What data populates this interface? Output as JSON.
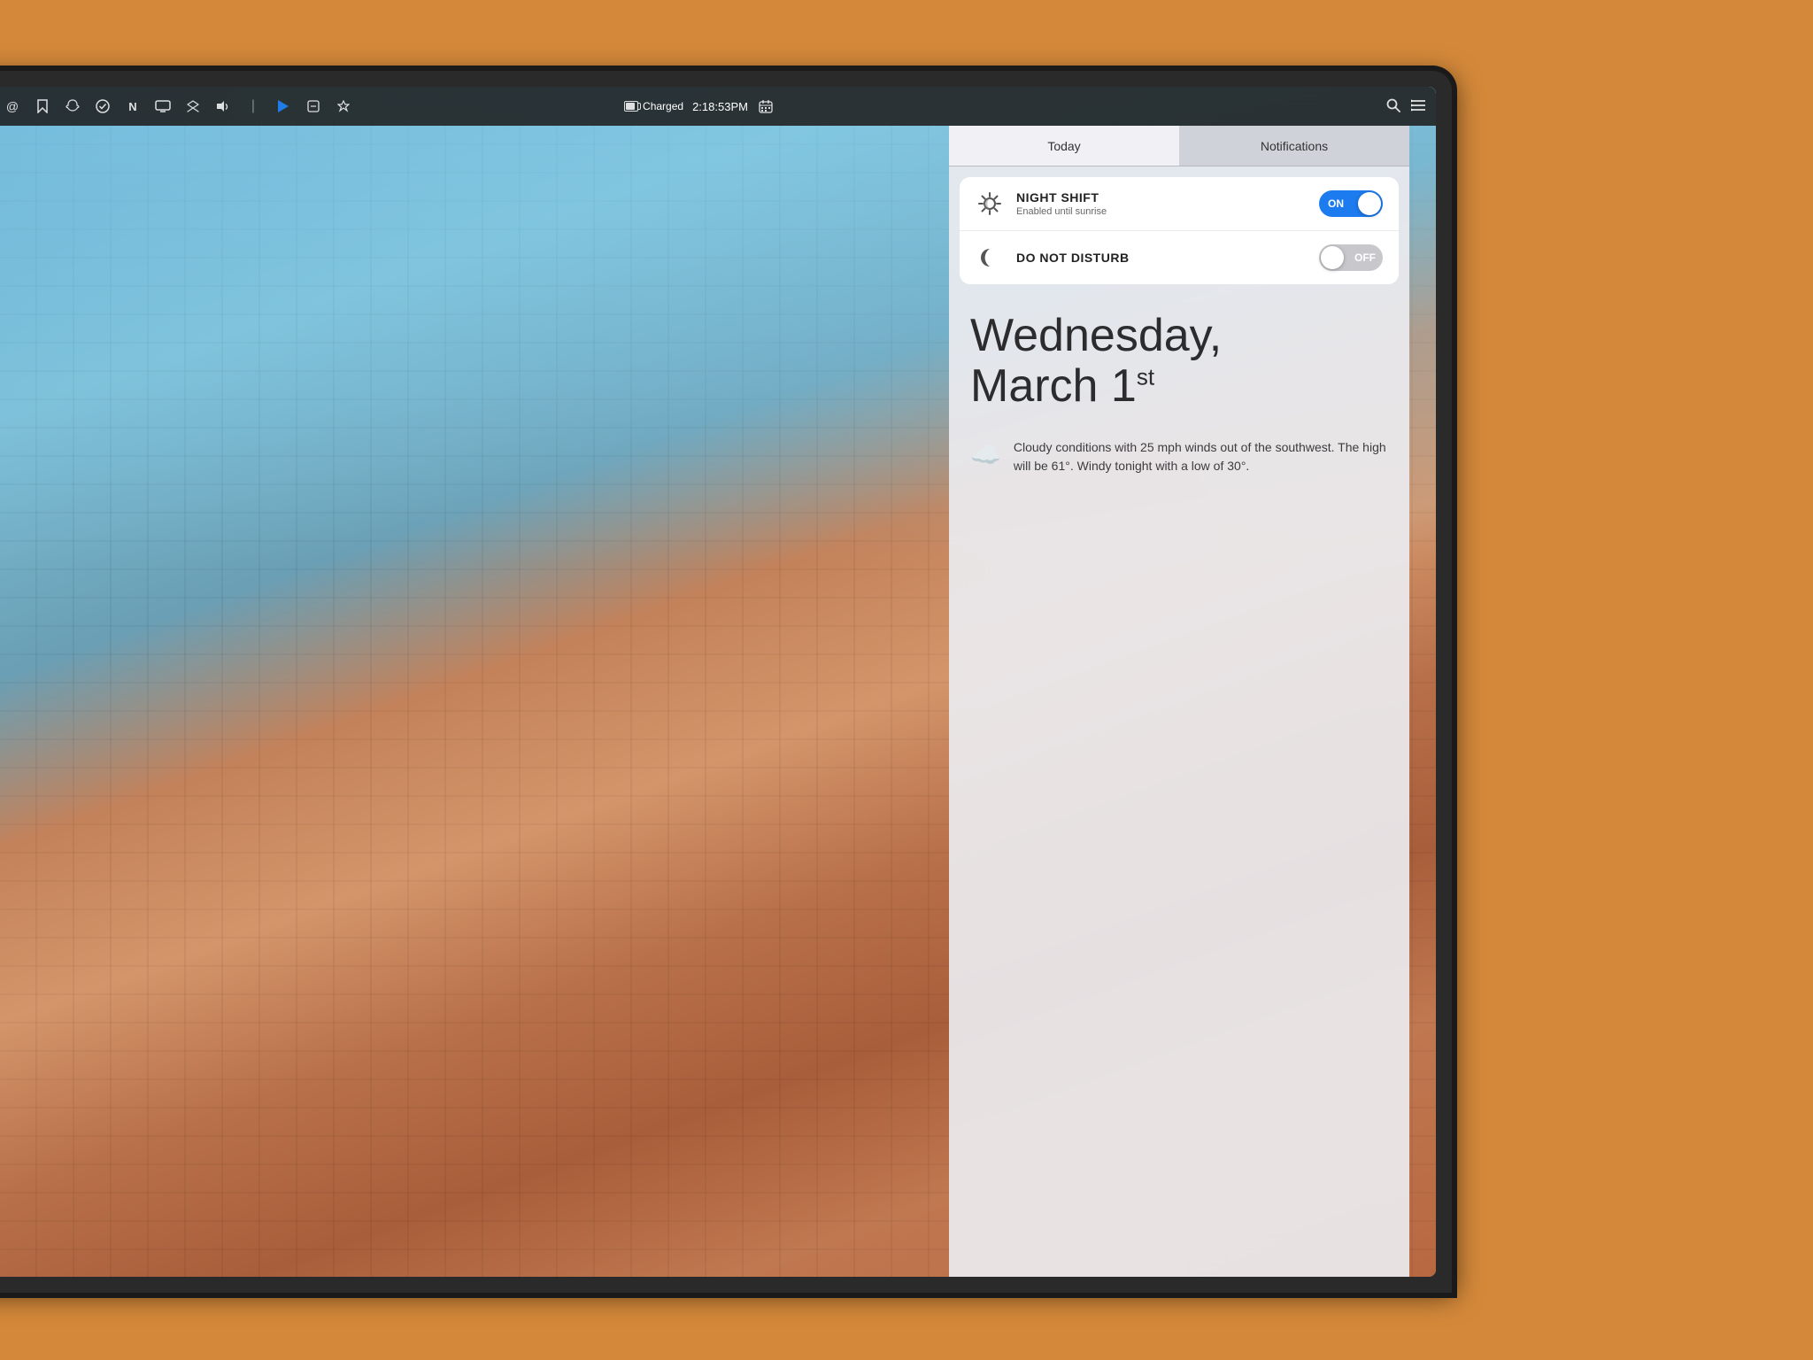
{
  "background_color": "#D4893A",
  "menubar": {
    "time": "2:18:53PM",
    "battery_status": "Charged",
    "icons_left": [
      "screen-icon",
      "at-icon",
      "bookmark-icon",
      "snapchat-icon",
      "check-icon",
      "n-icon",
      "monitor-icon",
      "dropbox-icon",
      "volume-icon",
      "divider-icon",
      "play-icon",
      "more-icons"
    ],
    "icons_right": [
      "calendar-grid-icon",
      "search-icon",
      "list-icon"
    ]
  },
  "notification_center": {
    "tabs": [
      {
        "id": "today",
        "label": "Today",
        "active": true
      },
      {
        "id": "notifications",
        "label": "Notifications",
        "active": false
      }
    ],
    "toggles": [
      {
        "id": "night-shift",
        "icon": "☀️",
        "title": "NIGHT SHIFT",
        "subtitle": "Enabled until sunrise",
        "state": "on",
        "on_label": "ON",
        "off_label": "OFF"
      },
      {
        "id": "do-not-disturb",
        "icon": "🌙",
        "title": "DO NOT DISTURB",
        "subtitle": "",
        "state": "off",
        "on_label": "ON",
        "off_label": "OFF"
      }
    ],
    "date": {
      "day_name": "Wednesday,",
      "month_day": "March 1",
      "superscript": "st"
    },
    "weather": {
      "icon": "☁️",
      "description": "Cloudy conditions with 25 mph winds out of the southwest. The high will be 61°. Windy tonight with a low of 30°."
    }
  }
}
